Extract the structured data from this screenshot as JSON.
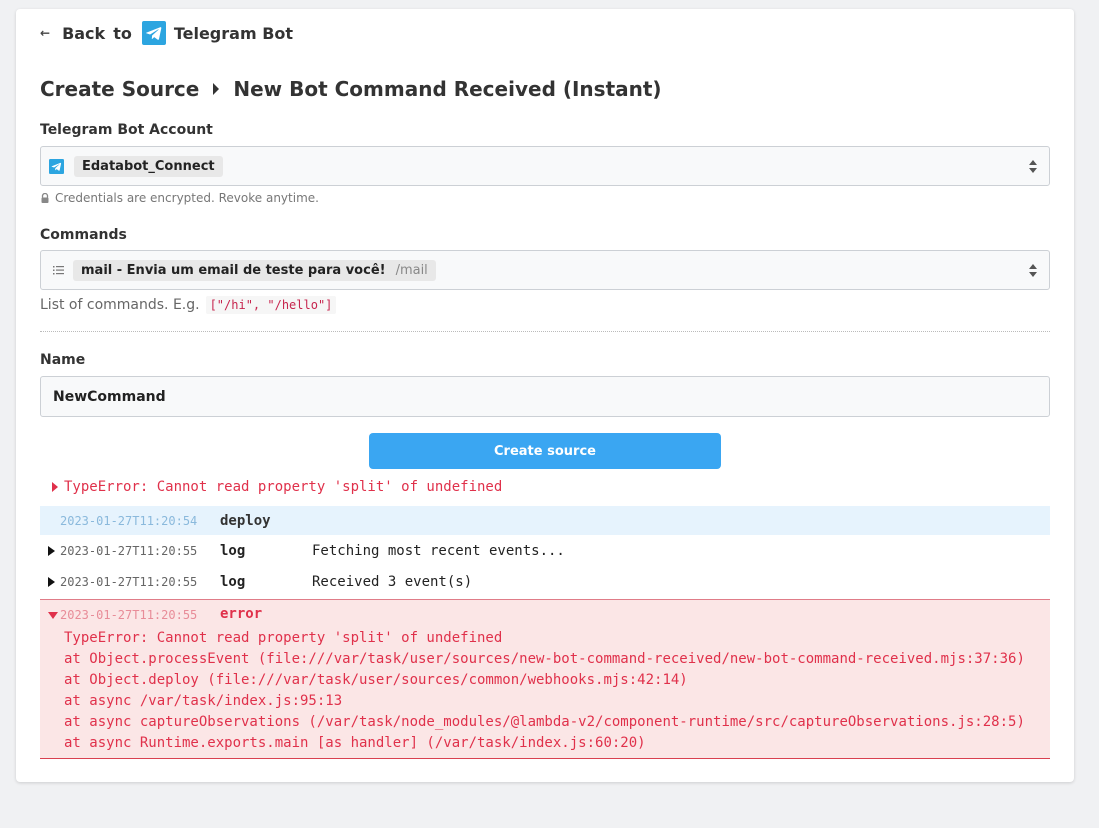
{
  "header": {
    "back_label": "Back",
    "to_label": "to",
    "app_name": "Telegram Bot"
  },
  "title": {
    "part1": "Create Source",
    "part2": "New Bot Command Received (Instant)"
  },
  "account": {
    "label": "Telegram Bot Account",
    "selected": "Edatabot_Connect",
    "hint": "Credentials are encrypted. Revoke anytime."
  },
  "commands": {
    "label": "Commands",
    "selected": "mail - Envia um email de teste para você!",
    "selected_value": "/mail",
    "hint_prefix": "List of commands. E.g.",
    "hint_code": "[\"/hi\", \"/hello\"]"
  },
  "name_field": {
    "label": "Name",
    "value": "NewCommand"
  },
  "create_button": "Create source",
  "error_summary": "TypeError: Cannot read property 'split' of undefined",
  "logs": [
    {
      "timestamp": "2023-01-27T11:20:54",
      "type": "deploy",
      "message": ""
    },
    {
      "timestamp": "2023-01-27T11:20:55",
      "type": "log",
      "message": "Fetching most recent events..."
    },
    {
      "timestamp": "2023-01-27T11:20:55",
      "type": "log",
      "message": "Received 3 event(s)"
    },
    {
      "timestamp": "2023-01-27T11:20:55",
      "type": "error",
      "message": ""
    }
  ],
  "stack_trace": [
    "TypeError: Cannot read property 'split' of undefined",
    "at Object.processEvent (file:///var/task/user/sources/new-bot-command-received/new-bot-command-received.mjs:37:36)",
    "at Object.deploy (file:///var/task/user/sources/common/webhooks.mjs:42:14)",
    "at async /var/task/index.js:95:13",
    "at async captureObservations (/var/task/node_modules/@lambda-v2/component-runtime/src/captureObservations.js:28:5)",
    "at async Runtime.exports.main [as handler] (/var/task/index.js:60:20)"
  ],
  "colors": {
    "accent": "#3aa6f2",
    "error": "#e0314b",
    "telegram": "#2ca5e0"
  }
}
